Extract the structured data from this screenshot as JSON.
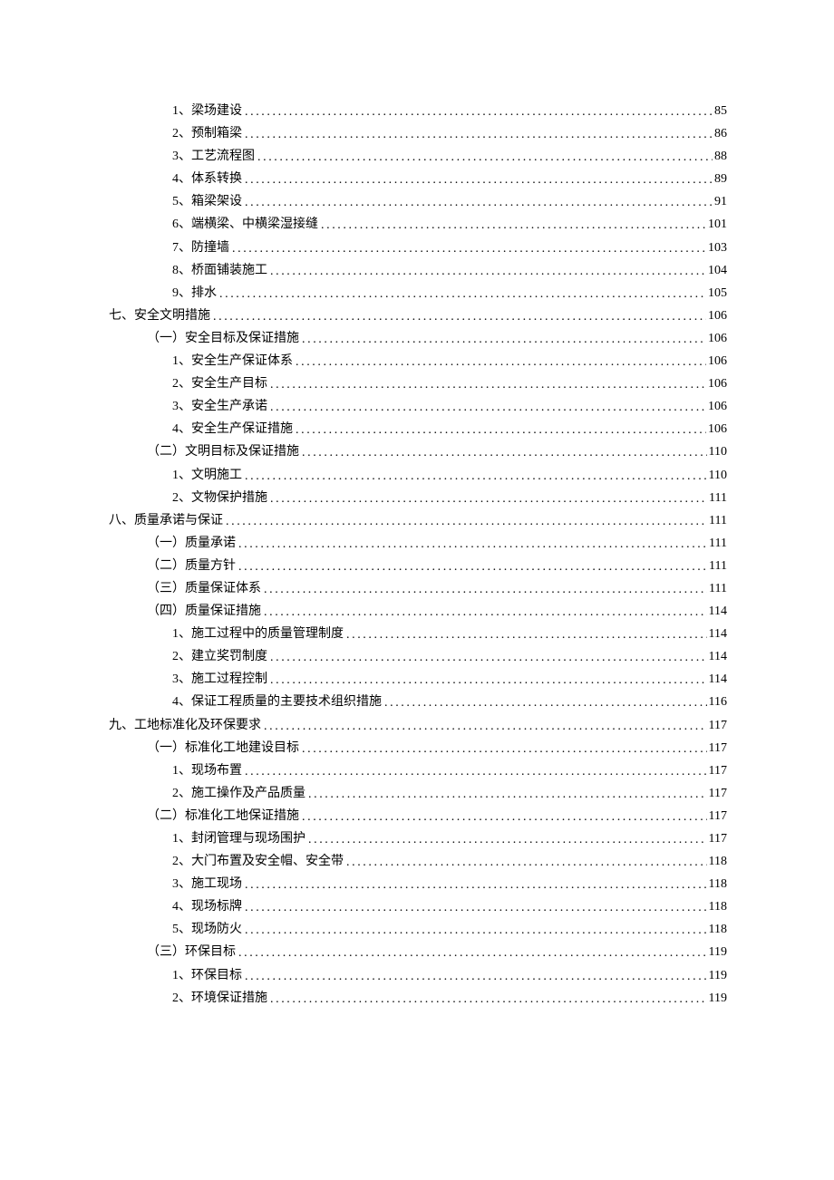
{
  "toc": [
    {
      "indent": 3,
      "label": "1、梁场建设",
      "page": "85"
    },
    {
      "indent": 3,
      "label": "2、预制箱梁",
      "page": "86"
    },
    {
      "indent": 3,
      "label": "3、工艺流程图",
      "page": "88"
    },
    {
      "indent": 3,
      "label": "4、体系转换",
      "page": "89"
    },
    {
      "indent": 3,
      "label": "5、箱梁架设",
      "page": "91"
    },
    {
      "indent": 3,
      "label": "6、端横梁、中横梁湿接缝",
      "page": "101"
    },
    {
      "indent": 3,
      "label": "7、防撞墙",
      "page": "103"
    },
    {
      "indent": 3,
      "label": "8、桥面铺装施工",
      "page": "104"
    },
    {
      "indent": 3,
      "label": "9、排水",
      "page": "105"
    },
    {
      "indent": 1,
      "label": "七、安全文明措施",
      "page": "106"
    },
    {
      "indent": 2,
      "label": "（一）安全目标及保证措施",
      "page": "106"
    },
    {
      "indent": 3,
      "label": "1、安全生产保证体系",
      "page": "106"
    },
    {
      "indent": 3,
      "label": "2、安全生产目标",
      "page": "106"
    },
    {
      "indent": 3,
      "label": "3、安全生产承诺",
      "page": "106"
    },
    {
      "indent": 3,
      "label": "4、安全生产保证措施",
      "page": "106"
    },
    {
      "indent": 2,
      "label": "（二）文明目标及保证措施",
      "page": "110"
    },
    {
      "indent": 3,
      "label": "1、文明施工",
      "page": "110"
    },
    {
      "indent": 3,
      "label": "2、文物保护措施",
      "page": "111"
    },
    {
      "indent": 1,
      "label": "八、质量承诺与保证",
      "page": "111"
    },
    {
      "indent": 2,
      "label": "（一）质量承诺",
      "page": "111"
    },
    {
      "indent": 2,
      "label": "（二）质量方针",
      "page": "111"
    },
    {
      "indent": 2,
      "label": "（三）质量保证体系",
      "page": "111"
    },
    {
      "indent": 2,
      "label": "（四）质量保证措施",
      "page": "114"
    },
    {
      "indent": 3,
      "label": "1、施工过程中的质量管理制度",
      "page": "114"
    },
    {
      "indent": 3,
      "label": "2、建立奖罚制度",
      "page": "114"
    },
    {
      "indent": 3,
      "label": "3、施工过程控制",
      "page": "114"
    },
    {
      "indent": 3,
      "label": "4、保证工程质量的主要技术组织措施",
      "page": "116"
    },
    {
      "indent": 1,
      "label": "九、工地标准化及环保要求",
      "page": "117"
    },
    {
      "indent": 2,
      "label": "（一）标准化工地建设目标",
      "page": "117"
    },
    {
      "indent": 3,
      "label": "1、现场布置",
      "page": "117"
    },
    {
      "indent": 3,
      "label": "2、施工操作及产品质量",
      "page": "117"
    },
    {
      "indent": 2,
      "label": "（二）标准化工地保证措施",
      "page": "117"
    },
    {
      "indent": 3,
      "label": "1、封闭管理与现场围护",
      "page": "117"
    },
    {
      "indent": 3,
      "label": "2、大门布置及安全帽、安全带",
      "page": "118"
    },
    {
      "indent": 3,
      "label": "3、施工现场",
      "page": "118"
    },
    {
      "indent": 3,
      "label": "4、现场标牌",
      "page": "118"
    },
    {
      "indent": 3,
      "label": "5、现场防火",
      "page": "118"
    },
    {
      "indent": 2,
      "label": "（三）环保目标",
      "page": "119"
    },
    {
      "indent": 3,
      "label": "1、环保目标",
      "page": "119"
    },
    {
      "indent": 3,
      "label": "2、环境保证措施",
      "page": "119"
    }
  ]
}
